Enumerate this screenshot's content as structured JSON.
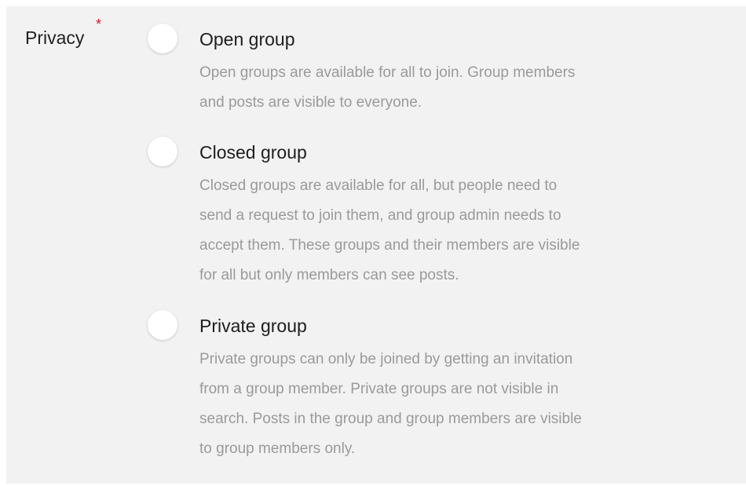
{
  "privacy": {
    "label": "Privacy",
    "required_marker": "*",
    "options": [
      {
        "title": "Open group",
        "description_lines": [
          "Open groups are available for all to join. Group members",
          "and posts are visible to everyone."
        ],
        "selected": false
      },
      {
        "title": "Closed group",
        "description_lines": [
          "Closed groups are available for all, but people need to",
          "send a request to join them, and group admin needs to",
          "accept them. These groups and their members are visible",
          "for all but only members can see posts."
        ],
        "selected": false
      },
      {
        "title": "Private group",
        "description_lines": [
          "Private groups can only be joined by getting an invitation",
          "from a group member. Private groups are not visible in",
          "search. Posts in the group and group members are visible",
          "to group members only."
        ],
        "selected": false
      }
    ]
  },
  "colors": {
    "panel_background": "#f2f2f2",
    "required_star": "#d0162e",
    "description_text": "#9a9a9a",
    "title_text": "#1e1e1e"
  }
}
